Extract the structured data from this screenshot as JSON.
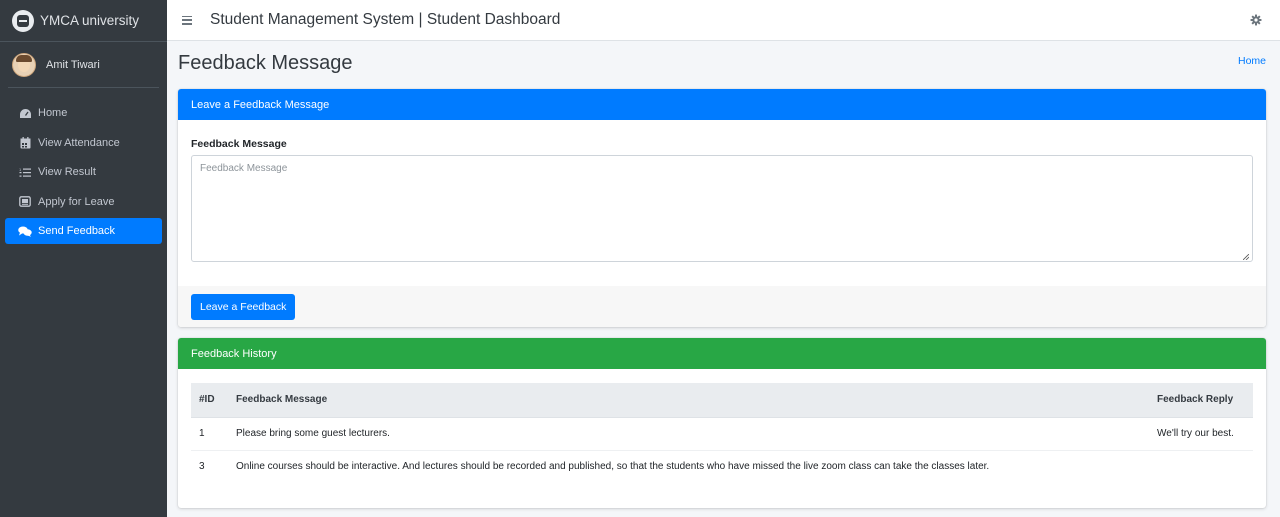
{
  "brand": {
    "name": "YMCA university"
  },
  "user": {
    "name": "Amit Tiwari"
  },
  "sidebar": {
    "items": [
      {
        "label": "Home",
        "icon": "dashboard-icon"
      },
      {
        "label": "View Attendance",
        "icon": "calendar-icon"
      },
      {
        "label": "View Result",
        "icon": "list-icon"
      },
      {
        "label": "Apply for Leave",
        "icon": "envelope-icon"
      },
      {
        "label": "Send Feedback",
        "icon": "comments-icon",
        "active": true
      }
    ]
  },
  "header": {
    "title": "Student Management System | Student Dashboard"
  },
  "page": {
    "title": "Feedback Message",
    "breadcrumb": "Home"
  },
  "feedback_form": {
    "card_title": "Leave a Feedback Message",
    "field_label": "Feedback Message",
    "placeholder": "Feedback Message",
    "submit_label": "Leave a Feedback"
  },
  "history": {
    "card_title": "Feedback History",
    "columns": [
      "#ID",
      "Feedback Message",
      "Feedback Reply"
    ],
    "rows": [
      {
        "id": "1",
        "message": "Please bring some guest lecturers.",
        "reply": "We'll try our best."
      },
      {
        "id": "3",
        "message": "Online courses should be interactive. And lectures should be recorded and published, so that the students who have missed the live zoom class can take the classes later.",
        "reply": ""
      }
    ]
  },
  "colors": {
    "primary": "#007bff",
    "success": "#28a745",
    "sidebar": "#343a40",
    "content_bg": "#f4f6f9"
  }
}
